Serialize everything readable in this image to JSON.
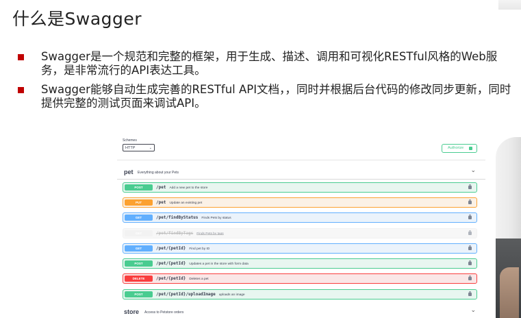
{
  "slide": {
    "title": "什么是Swagger",
    "bullets": [
      "Swagger是一个规范和完整的框架，用于生成、描述、调用和可视化RESTful风格的Web服务，是非常流行的API表达工具。",
      "Swagger能够自动生成完善的RESTful API文档，，同时并根据后台代码的修改同步更新，同时提供完整的测试页面来调试API。"
    ]
  },
  "swagger": {
    "schemes_label": "Schemes",
    "scheme_value": "HTTP",
    "authorize_label": "Authorize",
    "tags": [
      {
        "name": "pet",
        "description": "Everything about your Pets"
      },
      {
        "name": "store",
        "description": "Access to Petstore orders"
      }
    ],
    "operations": [
      {
        "method": "POST",
        "path": "/pet",
        "summary": "Add a new pet to the store",
        "style": "post"
      },
      {
        "method": "PUT",
        "path": "/pet",
        "summary": "Update an existing pet",
        "style": "put"
      },
      {
        "method": "GET",
        "path": "/pet/findByStatus",
        "summary": "Finds Pets by status",
        "style": "get"
      },
      {
        "method": "GET",
        "path": "/pet/findByTags",
        "summary": "Finds Pets by tags",
        "style": "deprecated"
      },
      {
        "method": "GET",
        "path": "/pet/{petId}",
        "summary": "Find pet by ID",
        "style": "get"
      },
      {
        "method": "POST",
        "path": "/pet/{petId}",
        "summary": "Updates a pet in the store with form data",
        "style": "post"
      },
      {
        "method": "DELETE",
        "path": "/pet/{petId}",
        "summary": "Deletes a pet",
        "style": "delete"
      },
      {
        "method": "POST",
        "path": "/pet/{petId}/uploadImage",
        "summary": "uploads an image",
        "style": "post"
      }
    ]
  },
  "colors": {
    "bullet": "#c00000",
    "post": "#49cc90",
    "put": "#fca130",
    "get": "#61affe",
    "delete": "#f93e3e"
  },
  "icons": [
    "chevron-down-icon",
    "lock-icon"
  ]
}
